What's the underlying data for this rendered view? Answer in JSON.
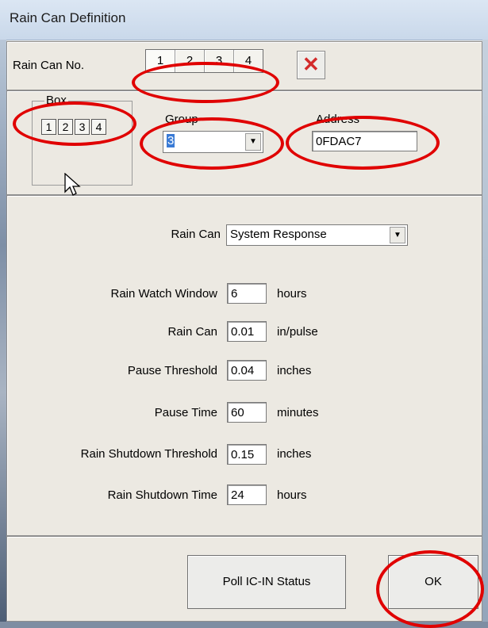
{
  "window": {
    "title": "Rain Can Definition"
  },
  "rain_can_no": {
    "label": "Rain Can No.",
    "tabs": [
      "1",
      "2",
      "3",
      "4"
    ],
    "selected": "1",
    "close_icon": "red-x-icon"
  },
  "box": {
    "legend": "Box",
    "buttons": [
      "1",
      "2",
      "3",
      "4"
    ]
  },
  "group": {
    "label": "Group",
    "value": "3"
  },
  "address": {
    "label": "Address",
    "value": "0FDAC7"
  },
  "rain_can_type": {
    "label": "Rain Can",
    "value": "System Response"
  },
  "settings": [
    {
      "label": "Rain Watch Window",
      "value": "6",
      "unit": "hours"
    },
    {
      "label": "Rain Can",
      "value": "0.01",
      "unit": "in/pulse"
    },
    {
      "label": "Pause Threshold",
      "value": "0.04",
      "unit": "inches"
    },
    {
      "label": "Pause Time",
      "value": "60",
      "unit": "minutes"
    },
    {
      "label": "Rain Shutdown Threshold",
      "value": "0.15",
      "unit": "inches"
    },
    {
      "label": "Rain Shutdown Time",
      "value": "24",
      "unit": "hours"
    }
  ],
  "buttons": {
    "poll": "Poll IC-IN Status",
    "ok": "OK"
  },
  "annotation_color": "#e00000"
}
